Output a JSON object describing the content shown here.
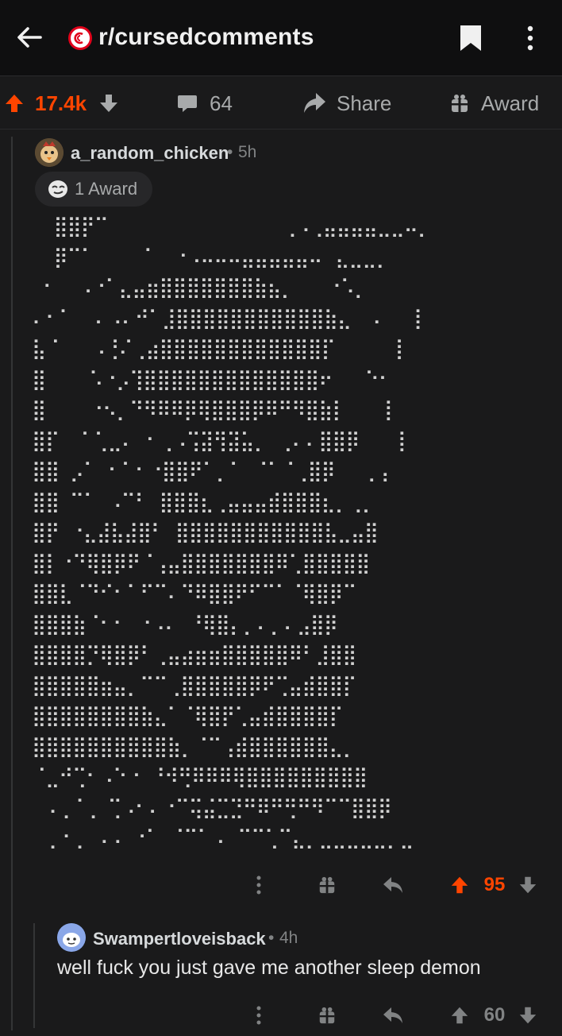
{
  "header": {
    "subreddit": "r/cursedcomments",
    "icons": [
      "back-arrow-icon",
      "subreddit-logo-icon",
      "bookmark-icon",
      "more-vertical-icon"
    ]
  },
  "post_actions": {
    "upvotes": "17.4k",
    "comments": "64",
    "share_label": "Share",
    "award_label": "Award"
  },
  "comment1": {
    "username": "a_random_chicken",
    "sep": "•",
    "age": "5h",
    "award_label": "1 Award",
    "votes": "95",
    "art_lines": [
      "  ⣿⣿⡟⠉                ⢀⠠⢀⣤⣤⣤⣤⣀⣀⠤⡀",
      "  ⡿⠉⠁    ⠈  ⠐⠠⠤⠤⠤⣤⣤⣤⣤⣤⠤⠀⣄⣀⣀⡀",
      " ⠂  ⠠⠐⠁⣄⣤⣶⣿⣿⣿⣿⣿⣿⣿⣷⣦⡀   ⠐⠡⡀",
      "⠄⠂⠁  ⠄⠠⠄⠚⠁⣸⣿⣿⣿⣿⣿⣿⣿⣿⣿⣿⣿⣷⣄  ⠄  ⢸",
      "⣧⠈   ⠠⢘⠌⢀⣴⣿⣿⣿⣿⣿⣿⣿⣿⣿⣿⣿⣿⡏     ⢸",
      "⣿    ⠡⠐⡠⢹⣿⣿⣿⣿⣿⣿⣿⣿⣿⣿⣿⣿⣿⠖   ⠑⠂",
      "⣿    ⠐⠢⡀⠙⠻⠿⠿⡿⢿⣿⣿⣿⡿⠿⠛⠻⣿⣷⡇   ⢸",
      "⣿⡏  ⠁⢁⣀⠄ ⠂⢀⠠⢩⣽⢻⣽⣥⡀ ⢀⠄⠄⣿⣿⡿   ⢸",
      "⣿⣿ ⡠⠁ ⠂⠁⠂⠐⣿⣿⠟⠁⡀⠁ ⠈⠁⠈⢀⣿⡿   ⡀⡄",
      "⣿⣿ ⠉⠁ ⠠⠉⠃ ⣿⣿⣿⣆⢀⣤⣤⣤⣾⣿⣿⣿⣆⡀⢀⡀",
      "⣿⡟ ⠐⣄⣼⣧⣼⣿⠃ ⣿⣿⣿⣿⣿⣿⣿⣿⣿⣿⣿⣧⣀⣤⣿",
      "⣿⡇⠐⠙⢿⣿⡿⠟⠈⢠⣤⣿⣿⣿⣿⣿⣿⣿⠿⢁⣿⣿⣿⣿⣿",
      "⣿⣿⣇⠈⠙⠊⠂⠁⠋⠉⠄⠙⠿⣿⣿⠟⠋⠉⠁⠈⢿⣿⡿⠉",
      "⣿⣿⣿⣷⠈⠂⠂ ⠐⠠⠄ ⠘⢿⣿⡄⡀⠄⡀⠄⣠⣿⡿",
      "⣿⣿⣿⣿⡙⢿⣿⡿⠃⢀⣤⣴⣶⣶⣿⣿⣿⣿⣿⠿⠃⣸⣿⣿",
      "⣿⣿⣿⣿⣿⣶⣤⡀⠉⠉⢀⣿⣿⣿⣿⣿⡿⠟⢉⣤⣾⣿⣿⡏",
      "⣿⣿⣿⣿⣿⣿⣿⣿⣷⣄⠁⠈⢿⣿⡟⢁⣤⣾⣿⣿⣿⣿⡏",
      "⣿⣿⣿⣿⣿⣿⣿⣿⣿⣿⣷⡀⠈⠉⢠⣾⣿⣿⣿⣿⣿⣿⣄⡀",
      "⠈⣀⠚⢉⠂⠠⠑⠐ ⠘⠺⢛⠿⠿⠿⢿⣿⣿⣿⣿⣿⣿⣿⣿⣿",
      " ⠠⢀⠈⢀ ⢉⠠⠂⠄⠐⠉⢭⣬⣉⣙⠛⠿⠛⢛⠛⠻⠉⠉⣿⣿⡿",
      " ⢀⠐⢀ ⠠⠠ ⠐⠁ ⠈⠉⠁⠠⠀⠉⠉⢁⠉⣄⡀⣀⣀⣀⣀⣀⡀⣀"
    ]
  },
  "comment2": {
    "username": "Swampertloveisback",
    "sep": "•",
    "age": "4h",
    "text": "well fuck you just gave me another sleep demon",
    "votes": "60"
  },
  "colors": {
    "background": "#1a1a1b",
    "upvote_active": "#ff4500",
    "muted": "#818384"
  }
}
